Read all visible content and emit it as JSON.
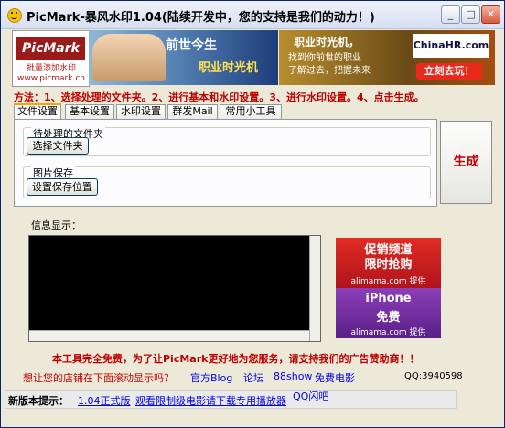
{
  "window": {
    "title": "PicMark-暴风水印1.04(陆续开发中，您的支持是我们的动力！)"
  },
  "banner": {
    "logo": {
      "name": "PicMark",
      "slogan": "批量添加水印",
      "url": "www.picmark.cn"
    },
    "ad_left": {
      "line1": "前世今生",
      "line2": "职业时光机"
    },
    "ad_right": {
      "line1": "职业时光机，",
      "line2": "找到你前世的职业",
      "line3": "了解过去，把握未来",
      "brand": "ChinaHR.com",
      "cta": "立刻去玩！"
    }
  },
  "steps_text": "方法：1、选择处理的文件夹。2、进行基本和水印设置。3、进行水印设置。4、点击生成。",
  "tabs": [
    "文件设置",
    "基本设置",
    "水印设置",
    "群发Mail",
    "常用小工具"
  ],
  "file_settings": {
    "source_group_label": "待处理的文件夹",
    "choose_folder_button": "选择文件夹",
    "save_group_label": "图片保存",
    "save_location_button": "设置保存位置"
  },
  "generate_button": "生成",
  "info_label": "信息显示：",
  "side_ad": {
    "top_line1": "促销频道",
    "top_line2": "限时抢购",
    "top_brand": "alimama.com 提供",
    "bottom_line1": "iPhone",
    "bottom_line2": "免费",
    "bottom_brand": "alimama.com 提供"
  },
  "free_notice": "本工具完全免费，为了让PicMark更好地为您服务，请支持我们的广告赞助商！！",
  "links": {
    "scroll_ad": "想让您的店铺在下面滚动显示吗？",
    "blog": "官方Blog",
    "forum": "论坛",
    "show": "88show",
    "movie": "免费电影",
    "qq": "QQ:3940598"
  },
  "status": {
    "label": "新版本提示：",
    "version_link": "1.04正式版",
    "download_link": "观看限制级电影请下载专用播放器",
    "qq_group_link": "QQ闪吧"
  },
  "colors": {
    "accent_red": "#c00000",
    "link_blue": "#0000ee"
  }
}
